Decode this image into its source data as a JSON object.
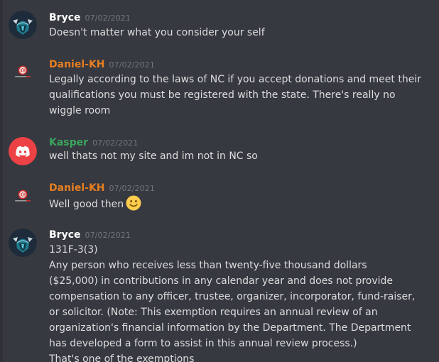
{
  "colors": {
    "background": "#36393f",
    "text": "#dcddde",
    "timestamp": "#72767d",
    "bryce": "#ffffff",
    "daniel": "#e67e22",
    "kasper": "#3ba55d",
    "discord_blurple_red": "#ed4245"
  },
  "messages": [
    {
      "author": "Bryce",
      "timestamp": "07/02/2021",
      "avatar_icon": "viking-helmet-icon",
      "lines": [
        "Doesn't matter what you consider your self"
      ]
    },
    {
      "author": "Daniel-KH",
      "timestamp": "07/02/2021",
      "avatar_icon": "kh-logo-icon",
      "lines": [
        "Legally according to the laws of NC if you accept donations and meet their",
        "qualifications you must be registered with the state. There's really no",
        "wiggle room"
      ]
    },
    {
      "author": "Kasper",
      "timestamp": "07/02/2021",
      "avatar_icon": "discord-logo-icon",
      "lines": [
        "well thats not my site and im not in NC so"
      ]
    },
    {
      "author": "Daniel-KH",
      "timestamp": "07/02/2021",
      "avatar_icon": "kh-logo-icon",
      "lines": [
        "Well good then"
      ],
      "emoji": "slightly-smiling-face-icon"
    },
    {
      "author": "Bryce",
      "timestamp": "07/02/2021",
      "avatar_icon": "viking-helmet-icon",
      "lines": [
        "131F-3(3)",
        "Any person who receives less than twenty-five thousand dollars",
        "($25,000) in contributions in any calendar year and does not provide",
        "compensation to any officer, trustee, organizer, incorporator, fund-raiser,",
        "or solicitor. (Note: This exemption requires an annual review of an",
        "organization's financial information by the Department. The Department",
        "has developed a form to assist in this annual review process.)",
        "That's one of the exemptions"
      ]
    }
  ]
}
